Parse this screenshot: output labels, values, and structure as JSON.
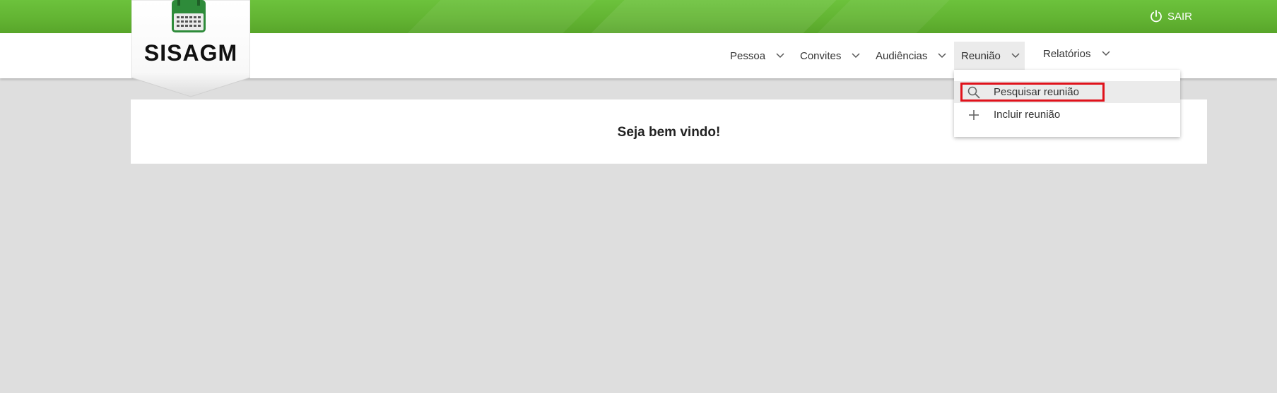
{
  "app": {
    "logo_text": "SISAGM",
    "logout_label": "SAIR"
  },
  "colors": {
    "topbar": "#62b332",
    "calendar": "#2e8b3a",
    "highlight": "#e0121b",
    "background": "#dedede"
  },
  "nav": {
    "items": [
      {
        "label": "Pessoa"
      },
      {
        "label": "Convites"
      },
      {
        "label": "Audiências"
      },
      {
        "label": "Reunião",
        "active": true
      },
      {
        "label": "Relatórios"
      }
    ]
  },
  "dropdown": {
    "items": [
      {
        "label": "Pesquisar reunião",
        "icon": "search-icon"
      },
      {
        "label": "Incluir reunião",
        "icon": "plus-icon"
      }
    ]
  },
  "main": {
    "welcome": "Seja bem vindo!"
  }
}
